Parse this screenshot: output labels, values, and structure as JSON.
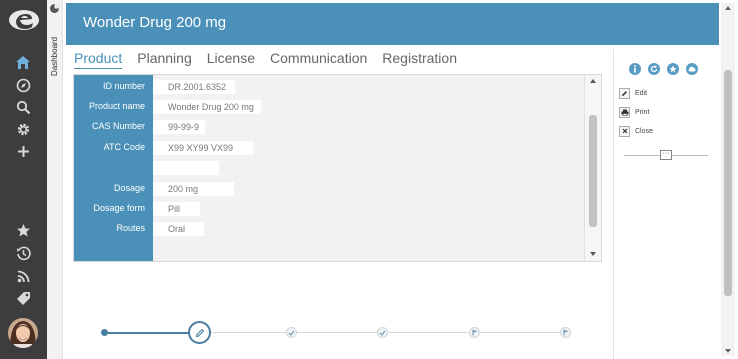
{
  "sidebar": {
    "items": [
      {
        "name": "home-icon"
      },
      {
        "name": "compass-icon"
      },
      {
        "name": "search-icon"
      },
      {
        "name": "gear-icon"
      },
      {
        "name": "plus-icon"
      },
      {
        "name": "star-icon"
      },
      {
        "name": "history-icon"
      },
      {
        "name": "rss-icon"
      },
      {
        "name": "tags-icon"
      }
    ],
    "colors": {
      "background": "#3d3d3f",
      "icon": "#d8d8d8",
      "active_icon": "#6fb1dc"
    }
  },
  "dashboard_strip": {
    "label": "Dashboard"
  },
  "header": {
    "title": "Wonder Drug 200 mg",
    "color": "#4a90b8"
  },
  "tabs": [
    {
      "label": "Product",
      "active": true
    },
    {
      "label": "Planning",
      "active": false
    },
    {
      "label": "License",
      "active": false
    },
    {
      "label": "Communication",
      "active": false
    },
    {
      "label": "Registration",
      "active": false
    }
  ],
  "form": {
    "fields": [
      {
        "label": "ID number",
        "value": "DR.2001.6352"
      },
      {
        "label": "Product name",
        "value": "Wonder Drug 200 mg"
      },
      {
        "label": "CAS Number",
        "value": "99-99-9"
      },
      {
        "label": "ATC Code",
        "value": "X99 XY99 VX99"
      },
      {
        "label": "",
        "value": ""
      },
      {
        "label": "Dosage",
        "value": "200 mg"
      },
      {
        "label": "Dosage form",
        "value": "Pill"
      },
      {
        "label": "Routes",
        "value": "Oral"
      }
    ]
  },
  "actions": {
    "top_icons": [
      "info-icon",
      "refresh-icon",
      "star-icon",
      "cloud-icon"
    ],
    "items": [
      {
        "label": "Edit",
        "icon": "pencil-icon"
      },
      {
        "label": "Print",
        "icon": "print-icon"
      },
      {
        "label": "Close",
        "icon": "close-icon"
      }
    ],
    "slider_knob": "···"
  },
  "stepper": {
    "steps": [
      {
        "state": "start"
      },
      {
        "state": "current",
        "icon": "pencil-icon"
      },
      {
        "state": "done",
        "icon": "check-icon"
      },
      {
        "state": "done",
        "icon": "check-icon"
      },
      {
        "state": "pending",
        "icon": "flag-icon"
      },
      {
        "state": "pending",
        "icon": "flag-icon"
      }
    ],
    "colors": {
      "progress": "#4a7ea3",
      "todo": "#d6d6d6"
    }
  }
}
